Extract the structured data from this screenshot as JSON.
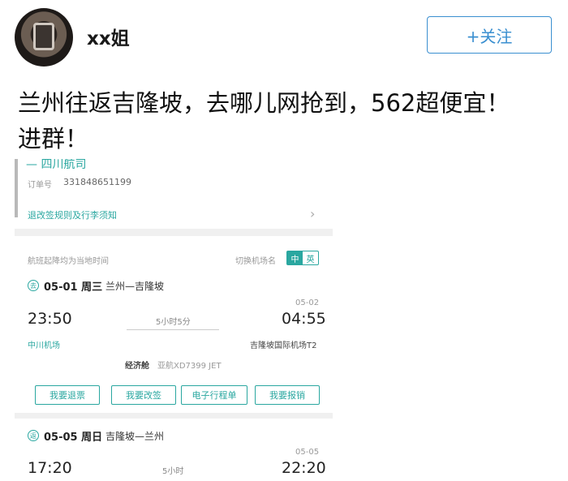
{
  "post": {
    "username": "xx姐",
    "follow_label": "+关注",
    "text": "兰州往返吉隆坡，去哪儿网抢到，562超便宜！\n进群！"
  },
  "order": {
    "top_cut_text": "— 四川航司",
    "order_label": "订单号",
    "order_number": "331848651199",
    "rules_link": "退改签规则及行李须知",
    "chevron": "›"
  },
  "settings": {
    "time_note": "航班起降均为当地时间",
    "switch_label": "切换机场名",
    "toggle_on": "中",
    "toggle_off": "英"
  },
  "segments": [
    {
      "icon": "去",
      "date": "05-01 周三",
      "route": "兰州—吉隆坡",
      "arrive_date": "05-02",
      "dep_time": "23:50",
      "duration": "5小时5分",
      "arr_time": "04:55",
      "dep_airport": "中川机场",
      "arr_airport": "吉隆坡国际机场T2",
      "cabin": "经济舱",
      "flight": "亚航XD7399 JET"
    },
    {
      "icon": "返",
      "date": "05-05 周日",
      "route": "吉隆坡—兰州",
      "arrive_date": "05-05",
      "dep_time": "17:20",
      "duration": "5小时",
      "arr_time": "22:20"
    }
  ],
  "actions": [
    "我要退票",
    "我要改签",
    "电子行程单",
    "我要报销"
  ],
  "colors": {
    "accent": "#2aa7a0",
    "follow": "#3a8fd0"
  }
}
